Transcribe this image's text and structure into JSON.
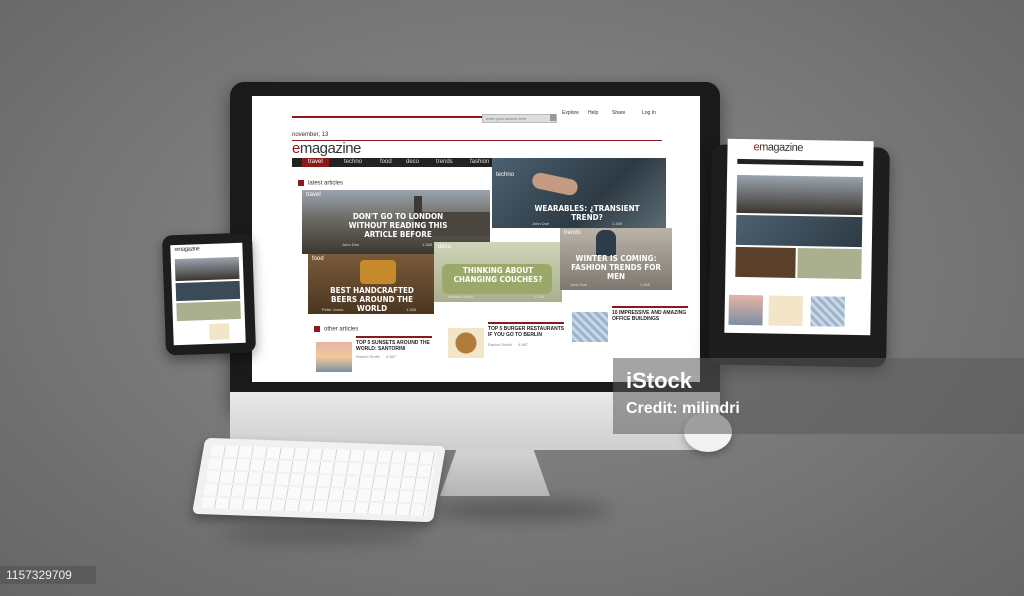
{
  "brand": {
    "prefix": "e",
    "name": "magazine"
  },
  "date_label": "november, 13",
  "search": {
    "placeholder": "enter your search term"
  },
  "top_nav": [
    "Explore",
    "Help",
    "Share",
    "Log In"
  ],
  "nav": [
    "travel",
    "techno",
    "food",
    "deco",
    "trends",
    "fashion",
    "games"
  ],
  "latest_title": "latest articles",
  "other_title": "other articles",
  "featured": [
    {
      "category": "travel",
      "headline": "Don't go to London without reading this article before",
      "author": "John Doe",
      "views": "1.345"
    },
    {
      "category": "techno",
      "headline": "Wearables: ¿transient trend?",
      "author": "John Doe",
      "views": "1.345"
    },
    {
      "category": "food",
      "headline": "Best handcrafted beers around the world",
      "author": "Peter Jones",
      "views": "1.345"
    },
    {
      "category": "deco",
      "headline": "Thinking about changing couches?",
      "author": "Melissa Smith",
      "views": "1.345"
    },
    {
      "category": "trends",
      "headline": "Winter is coming: fashion trends for men",
      "author": "John Doe",
      "views": "1.345"
    }
  ],
  "other": [
    {
      "title": "Top 5 sunsets around the world: Santorini",
      "author": "Rachel Smith",
      "views": "4.567"
    },
    {
      "title": "Top 5 burger restaurants if you go to Berlin",
      "author": "Rachel Smith",
      "views": "4.567"
    },
    {
      "title": "10 impressive and amazing office buildings",
      "author": "Rachel Smith",
      "views": "4.567"
    }
  ],
  "watermark": {
    "logo": "iStock",
    "credit": "Credit: milindri"
  },
  "stock_id": "1157329709",
  "colors": {
    "accent": "#8b1a1a",
    "navbar": "#222222",
    "background": "#777777"
  }
}
